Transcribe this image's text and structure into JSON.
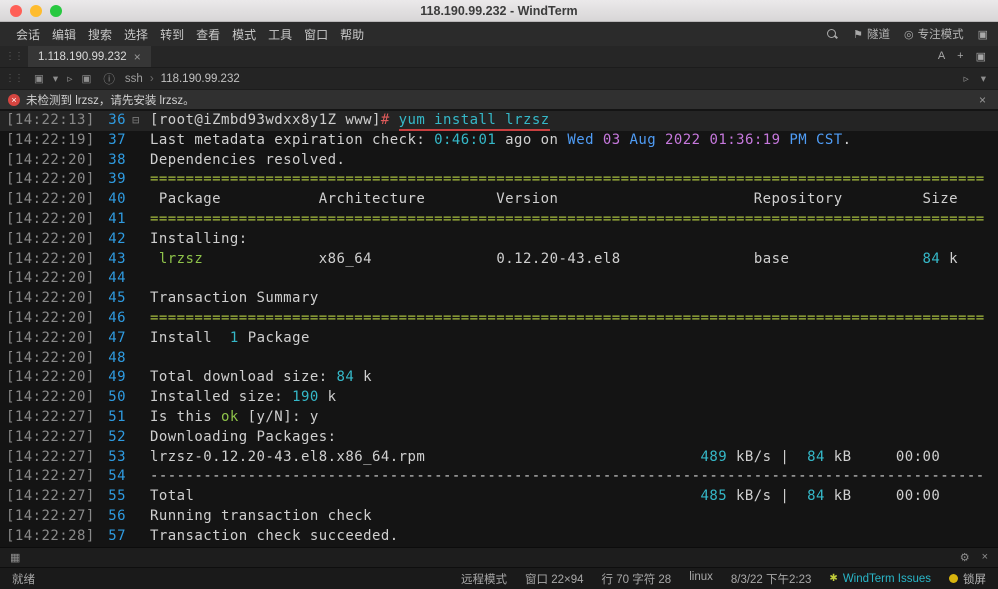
{
  "colors": {
    "terminal_bg": "#141414",
    "accent_cyan": "#35b8c8",
    "accent_green": "#8ec34a",
    "separator_green": "#a6bd3e",
    "date_blue": "#4f9cf5",
    "date_magenta": "#c678dd",
    "prompt_hash_red": "#e05b5b",
    "underline_red": "#c94040",
    "line_number_blue": "#2f9be0",
    "error_red": "#d64540",
    "link_cyan": "#29b6c8"
  },
  "window": {
    "title": "118.190.99.232 - WindTerm"
  },
  "icons": {
    "grip": "⋮⋮",
    "close": "×",
    "flag": "⚑",
    "focus": "◎",
    "square": "▣",
    "info": "ⓘ",
    "chevron": "›",
    "error": "×",
    "fold": "⊟",
    "panel": "▦",
    "paw": "✱"
  },
  "menubar": {
    "items": [
      "会话",
      "编辑",
      "搜索",
      "选择",
      "转到",
      "查看",
      "模式",
      "工具",
      "窗口",
      "帮助"
    ],
    "right": {
      "tunnel_label": "隧道",
      "focus_label": "专注模式"
    }
  },
  "tabbar": {
    "tab_title": "1.118.190.99.232",
    "buttons": [
      "A",
      "+",
      "▣"
    ]
  },
  "toolbar": {
    "left_icons": [
      "▣",
      "▾",
      "▹",
      "▣"
    ],
    "protocol": "ssh",
    "host": "118.190.99.232",
    "right_icons": [
      "▹",
      "▾"
    ]
  },
  "notification": {
    "message": "未检测到 lrzsz，请先安装 lrzsz。"
  },
  "terminal": {
    "cols": 94,
    "lines": [
      {
        "ts": "[14:22:13]",
        "num": "36",
        "fold": true,
        "hl": true,
        "seg": [
          {
            "t": "[root@iZmbd93wdxx8y1Z www]",
            "c": "def"
          },
          {
            "t": "#",
            "c": "red"
          },
          {
            "t": " ",
            "c": "def"
          },
          {
            "t": "yum install lrzsz",
            "c": "cmd"
          }
        ]
      },
      {
        "ts": "[14:22:19]",
        "num": "37",
        "seg": [
          {
            "t": "Last metadata expiration check: ",
            "c": "def"
          },
          {
            "t": "0:46:01",
            "c": "cyan"
          },
          {
            "t": " ago on ",
            "c": "def"
          },
          {
            "t": "Wed",
            "c": "blue"
          },
          {
            "t": " ",
            "c": "def"
          },
          {
            "t": "03",
            "c": "mag"
          },
          {
            "t": " ",
            "c": "def"
          },
          {
            "t": "Aug",
            "c": "blue"
          },
          {
            "t": " ",
            "c": "def"
          },
          {
            "t": "2022",
            "c": "mag"
          },
          {
            "t": " ",
            "c": "def"
          },
          {
            "t": "01:36:19",
            "c": "mag"
          },
          {
            "t": " ",
            "c": "def"
          },
          {
            "t": "PM",
            "c": "blue"
          },
          {
            "t": " ",
            "c": "def"
          },
          {
            "t": "CST",
            "c": "blue"
          },
          {
            "t": ".",
            "c": "def"
          }
        ]
      },
      {
        "ts": "[14:22:20]",
        "num": "38",
        "seg": [
          {
            "t": "Dependencies resolved.",
            "c": "def"
          }
        ]
      },
      {
        "ts": "[14:22:20]",
        "num": "39",
        "seg": [
          {
            "fill": "=",
            "c": "sep"
          }
        ]
      },
      {
        "ts": "[14:22:20]",
        "num": "40",
        "seg": [
          {
            "t": " Package",
            "c": "def"
          },
          {
            "pad": 11
          },
          {
            "t": "Architecture",
            "c": "def"
          },
          {
            "pad": 8
          },
          {
            "t": "Version",
            "c": "def"
          },
          {
            "pad": 22
          },
          {
            "t": "Repository",
            "c": "def"
          },
          {
            "pad": 9
          },
          {
            "t": "Size",
            "c": "def"
          }
        ]
      },
      {
        "ts": "[14:22:20]",
        "num": "41",
        "seg": [
          {
            "fill": "=",
            "c": "sep"
          }
        ]
      },
      {
        "ts": "[14:22:20]",
        "num": "42",
        "seg": [
          {
            "t": "Installing:",
            "c": "def"
          }
        ]
      },
      {
        "ts": "[14:22:20]",
        "num": "43",
        "seg": [
          {
            "t": " ",
            "c": "def"
          },
          {
            "t": "lrzsz",
            "c": "green"
          },
          {
            "pad": 13
          },
          {
            "t": "x86_64",
            "c": "def"
          },
          {
            "pad": 14
          },
          {
            "t": "0.12.20-43.el8",
            "c": "def"
          },
          {
            "pad": 15
          },
          {
            "t": "base",
            "c": "def"
          },
          {
            "pad": 15
          },
          {
            "t": "84",
            "c": "cyan"
          },
          {
            "t": " k",
            "c": "def"
          }
        ]
      },
      {
        "ts": "[14:22:20]",
        "num": "44",
        "seg": []
      },
      {
        "ts": "[14:22:20]",
        "num": "45",
        "seg": [
          {
            "t": "Transaction Summary",
            "c": "def"
          }
        ]
      },
      {
        "ts": "[14:22:20]",
        "num": "46",
        "seg": [
          {
            "fill": "=",
            "c": "sep"
          }
        ]
      },
      {
        "ts": "[14:22:20]",
        "num": "47",
        "seg": [
          {
            "t": "Install  ",
            "c": "def"
          },
          {
            "t": "1",
            "c": "cyan"
          },
          {
            "t": " Package",
            "c": "def"
          }
        ]
      },
      {
        "ts": "[14:22:20]",
        "num": "48",
        "seg": []
      },
      {
        "ts": "[14:22:20]",
        "num": "49",
        "seg": [
          {
            "t": "Total download size: ",
            "c": "def"
          },
          {
            "t": "84",
            "c": "cyan"
          },
          {
            "t": " k",
            "c": "def"
          }
        ]
      },
      {
        "ts": "[14:22:20]",
        "num": "50",
        "seg": [
          {
            "t": "Installed size: ",
            "c": "def"
          },
          {
            "t": "190",
            "c": "cyan"
          },
          {
            "t": " k",
            "c": "def"
          }
        ]
      },
      {
        "ts": "[14:22:27]",
        "num": "51",
        "seg": [
          {
            "t": "Is this ",
            "c": "def"
          },
          {
            "t": "ok",
            "c": "green"
          },
          {
            "t": " [y/N]: y",
            "c": "def"
          }
        ]
      },
      {
        "ts": "[14:22:27]",
        "num": "52",
        "seg": [
          {
            "t": "Downloading Packages:",
            "c": "def"
          }
        ]
      },
      {
        "ts": "[14:22:27]",
        "num": "53",
        "seg": [
          {
            "t": "lrzsz-0.12.20-43.el8.x86_64.rpm",
            "c": "def"
          },
          {
            "pad": 31
          },
          {
            "t": "489",
            "c": "cyan"
          },
          {
            "t": " kB/s |  ",
            "c": "def"
          },
          {
            "t": "84",
            "c": "cyan"
          },
          {
            "t": " kB",
            "c": "def"
          },
          {
            "pad": 5
          },
          {
            "t": "00:00",
            "c": "def"
          }
        ]
      },
      {
        "ts": "[14:22:27]",
        "num": "54",
        "seg": [
          {
            "fill": "-",
            "c": "def"
          }
        ]
      },
      {
        "ts": "[14:22:27]",
        "num": "55",
        "seg": [
          {
            "t": "Total",
            "c": "def"
          },
          {
            "pad": 57
          },
          {
            "t": "485",
            "c": "cyan"
          },
          {
            "t": " kB/s |  ",
            "c": "def"
          },
          {
            "t": "84",
            "c": "cyan"
          },
          {
            "t": " kB",
            "c": "def"
          },
          {
            "pad": 5
          },
          {
            "t": "00:00",
            "c": "def"
          }
        ]
      },
      {
        "ts": "[14:22:27]",
        "num": "56",
        "seg": [
          {
            "t": "Running transaction check",
            "c": "def"
          }
        ]
      },
      {
        "ts": "[14:22:28]",
        "num": "57",
        "seg": [
          {
            "t": "Transaction check succeeded.",
            "c": "def"
          }
        ]
      }
    ]
  },
  "panel": {
    "right_icons": [
      "⚙",
      "×"
    ]
  },
  "statusbar": {
    "ready": "就绪",
    "items": [
      "远程模式",
      "窗口 22×94",
      "行 70 字符 28",
      "linux",
      "8/3/22 下午2:23"
    ],
    "link": "WindTerm Issues",
    "lock": "锁屏"
  }
}
